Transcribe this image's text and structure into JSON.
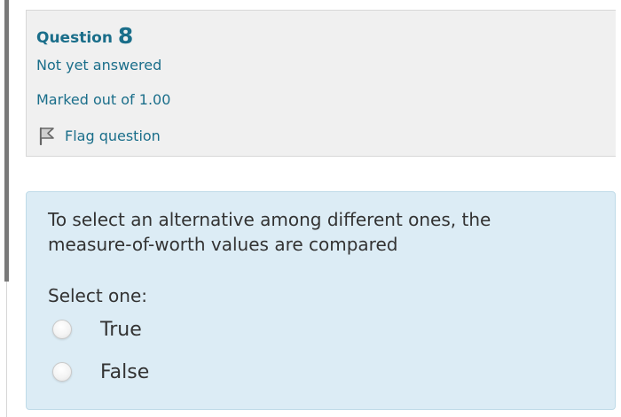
{
  "question_info": {
    "label": "Question",
    "number": "8",
    "state": "Not yet answered",
    "grade": "Marked out of 1.00",
    "flag_label": "Flag question",
    "flag_icon": "flag-icon"
  },
  "question": {
    "text": "To select an alternative among different ones, the measure-of-worth values are compared",
    "prompt": "Select one:",
    "options": [
      {
        "label": "True",
        "selected": false
      },
      {
        "label": "False",
        "selected": false
      }
    ]
  },
  "colors": {
    "accent_text": "#1a6e8a",
    "info_background": "#f0f0f0",
    "content_background": "#dcecf5"
  }
}
